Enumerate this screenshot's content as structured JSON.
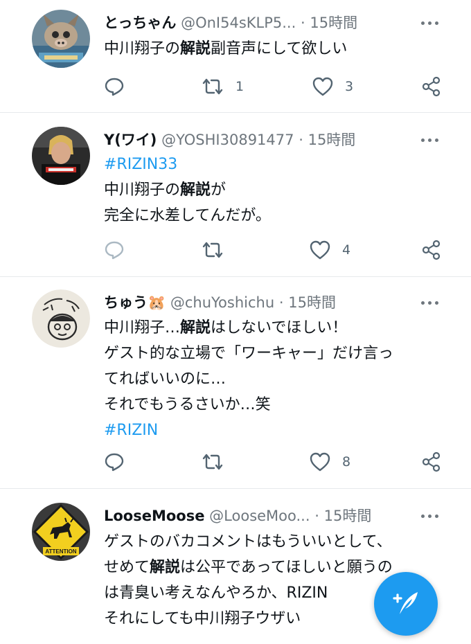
{
  "tweets": [
    {
      "name": "とっちゃん",
      "handle": "@OnI54sKLP5...",
      "dot": "·",
      "time": "15時間",
      "lines": [
        [
          {
            "t": "中川翔子の",
            "c": "text"
          },
          {
            "t": "解説",
            "c": "hl"
          },
          {
            "t": "副音声にして欲しい",
            "c": "text"
          }
        ]
      ],
      "counts": {
        "reply": "",
        "retweet": "1",
        "like": "3"
      },
      "avatar": "avatar-anime-mask"
    },
    {
      "name": "Y(ワイ)",
      "handle": "@YOSHI30891477",
      "dot": "·",
      "time": "15時間",
      "lines": [
        [
          {
            "t": "#RIZIN33",
            "c": "tag"
          }
        ],
        [
          {
            "t": "中川翔子の",
            "c": "text"
          },
          {
            "t": "解説",
            "c": "hl"
          },
          {
            "t": "が",
            "c": "text"
          }
        ],
        [
          {
            "t": "完全に水差してんだが。",
            "c": "text"
          }
        ]
      ],
      "counts": {
        "reply": "",
        "retweet": "",
        "like": "4"
      },
      "avatar": "avatar-wrestler"
    },
    {
      "name": "ちゅう",
      "emoji": "🐹",
      "handle": "@chuYoshichu",
      "dot": "·",
      "time": "15時間",
      "lines": [
        [
          {
            "t": "中川翔子…",
            "c": "text"
          },
          {
            "t": "解説",
            "c": "hl"
          },
          {
            "t": "はしないでほしい！",
            "c": "text"
          }
        ],
        [
          {
            "t": "ゲスト的な立場で「ワーキャー」だけ言っ",
            "c": "text"
          }
        ],
        [
          {
            "t": "てればいいのに…",
            "c": "text"
          }
        ],
        [
          {
            "t": "それでもうるさいか…笑",
            "c": "text"
          }
        ],
        [
          {
            "t": "#RIZIN",
            "c": "tag"
          }
        ]
      ],
      "counts": {
        "reply": "",
        "retweet": "",
        "like": "8"
      },
      "avatar": "avatar-drawing"
    },
    {
      "name": "LooseMoose",
      "handle": "@LooseMoo...",
      "dot": "·",
      "time": "15時間",
      "lines": [
        [
          {
            "t": "ゲストのバカコメントはもういいとして、",
            "c": "text"
          }
        ],
        [
          {
            "t": "せめて",
            "c": "text"
          },
          {
            "t": "解説",
            "c": "hl"
          },
          {
            "t": "は公平であってほしいと願うの",
            "c": "text"
          }
        ],
        [
          {
            "t": "は青臭い考えなんやろか、RIZIN",
            "c": "text"
          }
        ],
        [
          {
            "t": "それにしても中川翔子ウザい",
            "c": "text"
          }
        ]
      ],
      "counts": {
        "reply": "",
        "retweet": "",
        "like": ""
      },
      "avatar": "avatar-moose-sign",
      "avatar_sign_text": "ATTENTION"
    }
  ],
  "compose": {
    "icon": "compose-tweet-icon"
  },
  "colors": {
    "accent": "#1d9bf0",
    "muted": "#6e767d",
    "text": "#0f1419",
    "divider": "#e6e9ec"
  }
}
